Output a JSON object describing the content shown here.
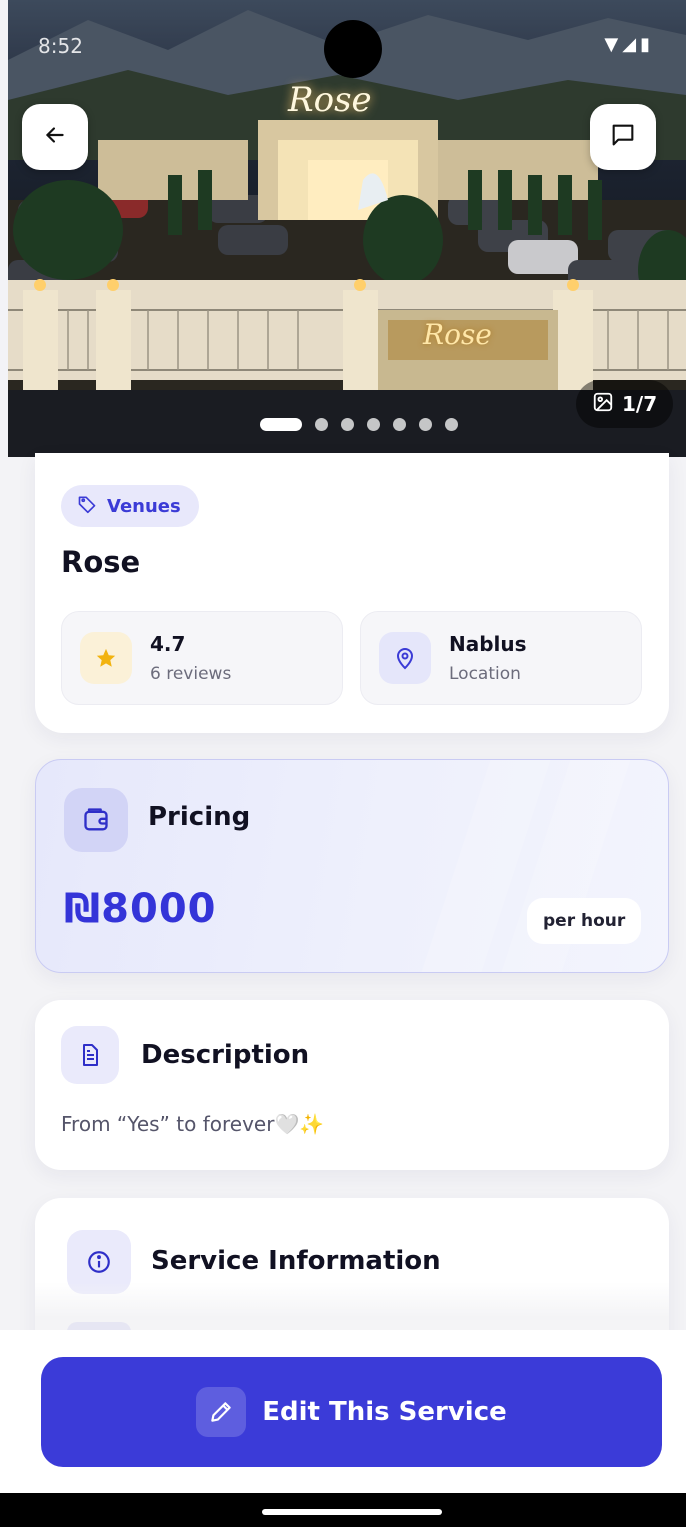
{
  "status_bar": {
    "time": "8:52",
    "icons": "▼◢▮"
  },
  "hero": {
    "signage": "Rose",
    "gate_sign": "Rose",
    "counter_text": "1/7",
    "total_images": 7,
    "current_index": 1
  },
  "header_buttons": {
    "back_icon": "arrow-left-icon",
    "chat_icon": "message-square-icon"
  },
  "listing": {
    "category": "Venues",
    "title": "Rose",
    "rating": "4.7",
    "reviews": "6 reviews",
    "location": "Nablus",
    "location_label": "Location"
  },
  "pricing": {
    "title": "Pricing",
    "price": "₪8000",
    "unit": "per hour"
  },
  "description": {
    "title": "Description",
    "text": "From “Yes” to forever🤍✨"
  },
  "service_info": {
    "title": "Service Information"
  },
  "actions": {
    "edit_label": "Edit This Service"
  },
  "colors": {
    "accent": "#3b3bd8",
    "star": "#f2b30f",
    "chip_bg": "#e8e8fb"
  }
}
